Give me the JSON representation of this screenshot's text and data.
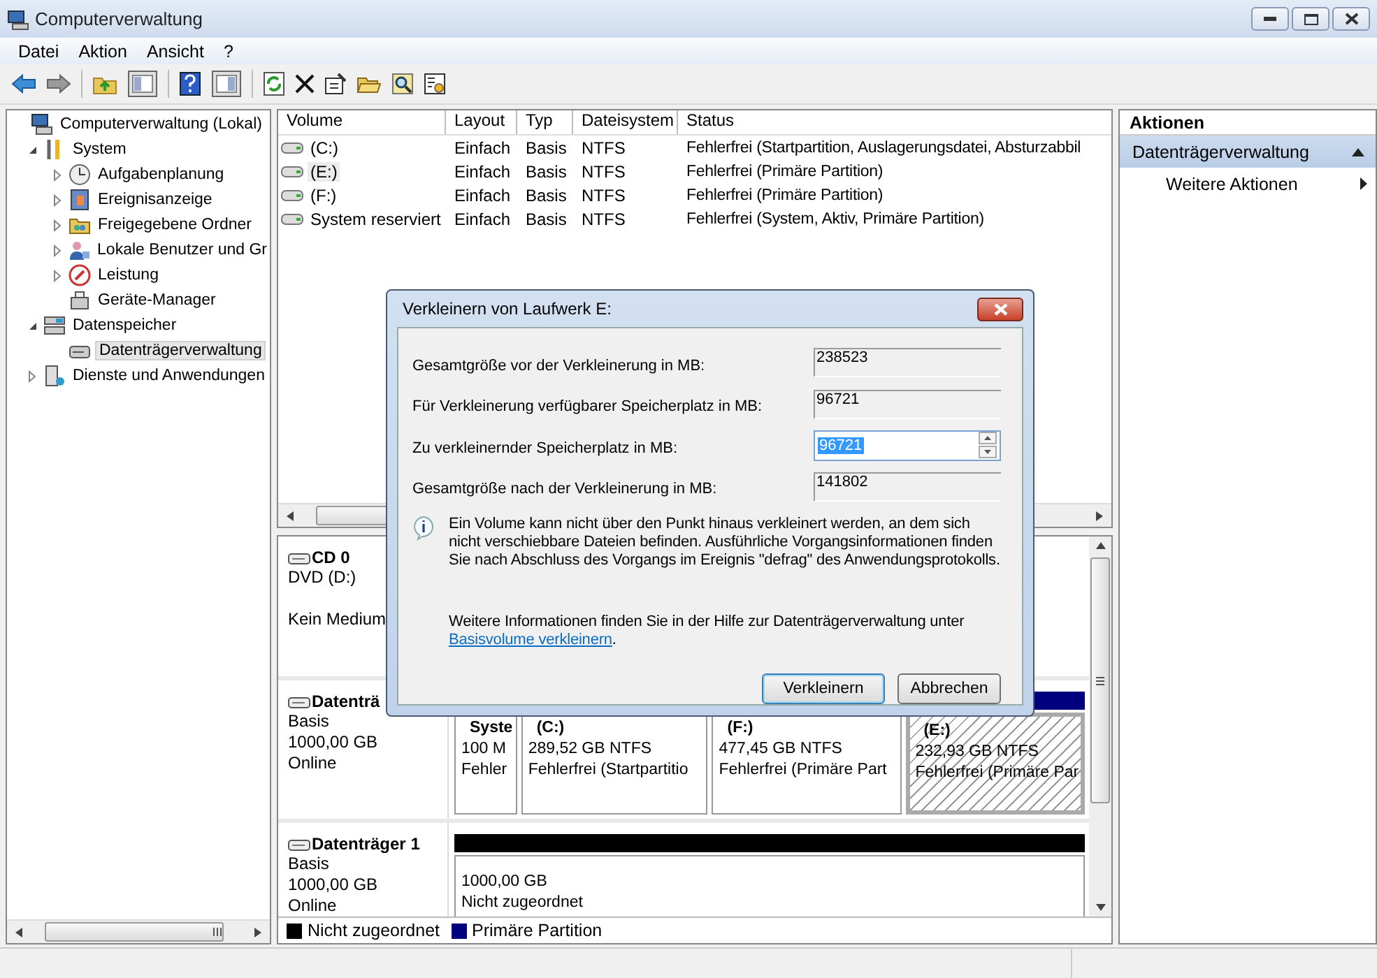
{
  "window": {
    "title": "Computerverwaltung"
  },
  "menu": [
    "Datei",
    "Aktion",
    "Ansicht",
    "?"
  ],
  "tree": [
    {
      "label": "Computerverwaltung (Lokal)",
      "selected": false,
      "children": [
        {
          "label": "System",
          "expanded": true,
          "selected": false,
          "children": [
            {
              "label": "Aufgabenplanung",
              "expanded": false,
              "selected": false
            },
            {
              "label": "Ereignisanzeige",
              "expanded": false,
              "selected": false
            },
            {
              "label": "Freigegebene Ordner",
              "expanded": false,
              "selected": false
            },
            {
              "label": "Lokale Benutzer und Gr",
              "expanded": false,
              "selected": false
            },
            {
              "label": "Leistung",
              "expanded": false,
              "selected": false
            },
            {
              "label": "Geräte-Manager",
              "selected": false
            }
          ]
        },
        {
          "label": "Datenspeicher",
          "expanded": true,
          "selected": false,
          "children": [
            {
              "label": "Datenträgerverwaltung",
              "selected": true
            }
          ]
        },
        {
          "label": "Dienste und Anwendungen",
          "expanded": false,
          "selected": false
        }
      ]
    }
  ],
  "volume_table": {
    "columns": [
      "Volume",
      "Layout",
      "Typ",
      "Dateisystem",
      "Status"
    ],
    "rows": [
      {
        "cells": [
          "(C:)",
          "Einfach",
          "Basis",
          "NTFS",
          "Fehlerfrei (Startpartition, Auslagerungsdatei, Absturzabbil"
        ],
        "selected": false
      },
      {
        "cells": [
          "(E:)",
          "Einfach",
          "Basis",
          "NTFS",
          "Fehlerfrei (Primäre Partition)"
        ],
        "selected": true
      },
      {
        "cells": [
          "(F:)",
          "Einfach",
          "Basis",
          "NTFS",
          "Fehlerfrei (Primäre Partition)"
        ],
        "selected": false
      },
      {
        "cells": [
          "System reserviert",
          "Einfach",
          "Basis",
          "NTFS",
          "Fehlerfrei (System, Aktiv, Primäre Partition)"
        ],
        "selected": false
      }
    ]
  },
  "disks": [
    {
      "name": "CD 0",
      "lines": [
        "DVD (D:)",
        "Kein Medium"
      ]
    },
    {
      "name": "Datenträ",
      "lines": [
        "Basis",
        "1000,00 GB",
        "Online"
      ],
      "color": "#00007f",
      "partitions": [
        {
          "header": "Syste",
          "size": "100 M",
          "status": "Fehler",
          "selected": false
        },
        {
          "header": "(C:)",
          "size": "289,52 GB NTFS",
          "status": "Fehlerfrei (Startpartitio",
          "selected": false
        },
        {
          "header": "(F:)",
          "size": "477,45 GB NTFS",
          "status": "Fehlerfrei (Primäre Part",
          "selected": false
        },
        {
          "header": "(E:)",
          "size": "232,93 GB NTFS",
          "status": "Fehlerfrei (Primäre Par",
          "selected": true
        }
      ]
    },
    {
      "name": "Datenträger 1",
      "lines": [
        "Basis",
        "1000,00 GB",
        "Online"
      ],
      "color": "#000000",
      "partitions": [
        {
          "size": "1000,00 GB",
          "status": "Nicht zugeordnet",
          "selected": false
        }
      ]
    }
  ],
  "legend": [
    {
      "label": "Nicht zugeordnet",
      "color": "#000000"
    },
    {
      "label": "Primäre Partition",
      "color": "#00007f"
    }
  ],
  "actions": {
    "title": "Aktionen",
    "section": "Datenträgerverwaltung",
    "items": [
      "Weitere Aktionen"
    ]
  },
  "dialog": {
    "title": "Verkleinern von Laufwerk E:",
    "fields": [
      {
        "label": "Gesamtgröße vor der Verkleinerung in MB:",
        "value": "238523",
        "kind": "readonly"
      },
      {
        "label": "Für Verkleinerung verfügbarer Speicherplatz in MB:",
        "value": "96721",
        "kind": "readonly"
      },
      {
        "label": "Zu verkleinernder Speicherplatz in MB:",
        "value": "96721",
        "kind": "spin",
        "highlighted": true
      },
      {
        "label": "Gesamtgröße nach der Verkleinerung in MB:",
        "value": "141802",
        "kind": "readonly"
      }
    ],
    "info": "Ein Volume kann nicht über den Punkt hinaus verkleinert werden, an dem sich nicht verschiebbare Dateien befinden. Ausführliche Vorgangsinformationen finden Sie nach Abschluss des Vorgangs im Ereignis \"defrag\" des Anwendungsprotokolls.",
    "help": {
      "text": "Weitere Informationen finden Sie in der Hilfe zur Datenträgerverwaltung unter",
      "link": "Basisvolume verkleinern",
      "after": "."
    },
    "buttons": [
      {
        "label": "Verkleinern",
        "default": true
      },
      {
        "label": "Abbrechen",
        "default": false
      }
    ]
  }
}
